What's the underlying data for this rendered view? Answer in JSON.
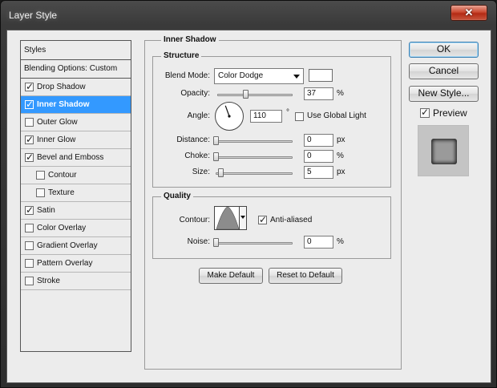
{
  "window": {
    "title": "Layer Style",
    "close_glyph": "✕"
  },
  "styles_list": {
    "header": "Styles",
    "blending_options": "Blending Options: Custom",
    "items": [
      {
        "label": "Drop Shadow",
        "checked": true,
        "selected": false,
        "sub": false
      },
      {
        "label": "Inner Shadow",
        "checked": true,
        "selected": true,
        "sub": false
      },
      {
        "label": "Outer Glow",
        "checked": false,
        "selected": false,
        "sub": false
      },
      {
        "label": "Inner Glow",
        "checked": true,
        "selected": false,
        "sub": false
      },
      {
        "label": "Bevel and Emboss",
        "checked": true,
        "selected": false,
        "sub": false
      },
      {
        "label": "Contour",
        "checked": false,
        "selected": false,
        "sub": true
      },
      {
        "label": "Texture",
        "checked": false,
        "selected": false,
        "sub": true
      },
      {
        "label": "Satin",
        "checked": true,
        "selected": false,
        "sub": false
      },
      {
        "label": "Color Overlay",
        "checked": false,
        "selected": false,
        "sub": false
      },
      {
        "label": "Gradient Overlay",
        "checked": false,
        "selected": false,
        "sub": false
      },
      {
        "label": "Pattern Overlay",
        "checked": false,
        "selected": false,
        "sub": false
      },
      {
        "label": "Stroke",
        "checked": false,
        "selected": false,
        "sub": false
      }
    ]
  },
  "inner_shadow": {
    "title": "Inner Shadow",
    "structure": {
      "title": "Structure",
      "blend_mode_label": "Blend Mode:",
      "blend_mode_value": "Color Dodge",
      "shadow_color": "#ffffff",
      "opacity_label": "Opacity:",
      "opacity_value": "37",
      "opacity_unit": "%",
      "angle_label": "Angle:",
      "angle_value": "110",
      "angle_unit": "°",
      "use_global_light_label": "Use Global Light",
      "use_global_light": false,
      "distance_label": "Distance:",
      "distance_value": "0",
      "distance_unit": "px",
      "choke_label": "Choke:",
      "choke_value": "0",
      "choke_unit": "%",
      "size_label": "Size:",
      "size_value": "5",
      "size_unit": "px"
    },
    "quality": {
      "title": "Quality",
      "contour_label": "Contour:",
      "anti_aliased_label": "Anti-aliased",
      "anti_aliased": true,
      "noise_label": "Noise:",
      "noise_value": "0",
      "noise_unit": "%"
    },
    "make_default_label": "Make Default",
    "reset_default_label": "Reset to Default"
  },
  "buttons": {
    "ok": "OK",
    "cancel": "Cancel",
    "new_style": "New Style...",
    "preview_label": "Preview",
    "preview_checked": true
  },
  "colors": {
    "selection": "#3399ff",
    "dialog_bg": "#ececec"
  },
  "check_glyph": "✓"
}
